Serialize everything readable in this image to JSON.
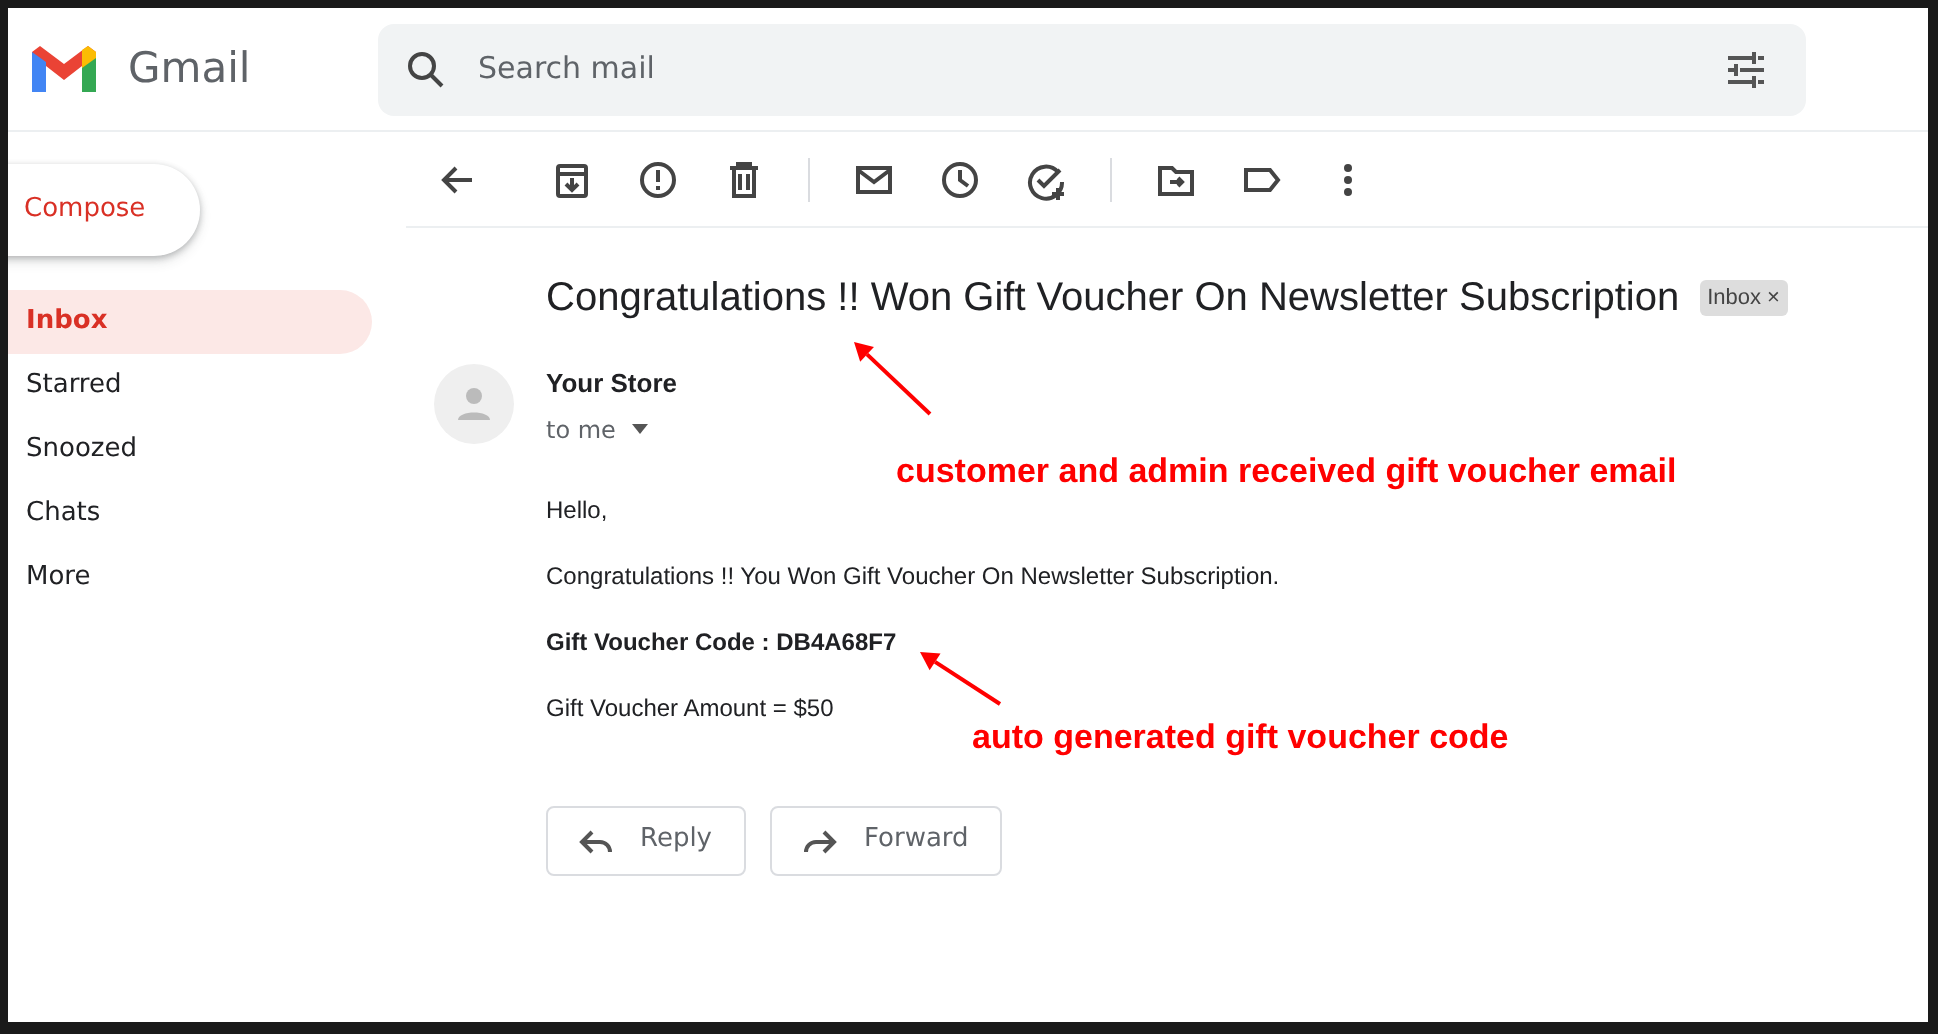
{
  "app": {
    "name": "Gmail"
  },
  "search": {
    "placeholder": "Search mail"
  },
  "compose": {
    "label": "Compose"
  },
  "sidebar": {
    "items": [
      {
        "label": "Inbox",
        "selected": true
      },
      {
        "label": "Starred",
        "selected": false
      },
      {
        "label": "Snoozed",
        "selected": false
      },
      {
        "label": "Chats",
        "selected": false
      },
      {
        "label": "More",
        "selected": false
      }
    ]
  },
  "message": {
    "subject": "Congratulations !! Won Gift Voucher On Newsletter Subscription",
    "label_chip": "Inbox",
    "chip_close": "×",
    "sender": "Your Store",
    "recipient": "to me",
    "body": [
      {
        "text": "Hello,",
        "bold": false
      },
      {
        "text": "Congratulations !! You Won Gift Voucher On Newsletter Subscription.",
        "bold": false
      },
      {
        "text": "Gift Voucher Code : DB4A68F7",
        "bold": true
      },
      {
        "text": "Gift Voucher Amount = $50",
        "bold": false
      }
    ],
    "actions": [
      "Reply",
      "Forward"
    ]
  },
  "annotations": [
    {
      "text": "customer and admin received gift voucher email"
    },
    {
      "text": "auto generated gift voucher code"
    }
  ]
}
